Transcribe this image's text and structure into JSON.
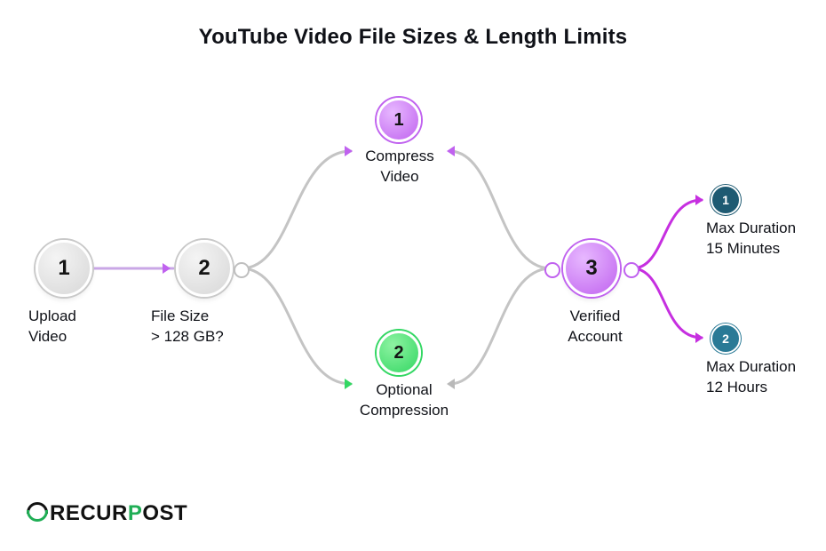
{
  "title": "YouTube Video File Sizes & Length Limits",
  "nodes": {
    "upload": {
      "num": "1",
      "label": "Upload\nVideo"
    },
    "filesize": {
      "num": "2",
      "label": "File Size\n> 128 GB?"
    },
    "compress": {
      "num": "1",
      "label": "Compress\nVideo"
    },
    "optional": {
      "num": "2",
      "label": "Optional\nCompression"
    },
    "verified": {
      "num": "3",
      "label": "Verified\nAccount"
    },
    "dur15": {
      "num": "1",
      "label": "Max Duration\n15 Minutes"
    },
    "dur12": {
      "num": "2",
      "label": "Max Duration\n12 Hours"
    }
  },
  "logo": {
    "part1": "RECUR",
    "part2": "P",
    "part3": "OST"
  }
}
